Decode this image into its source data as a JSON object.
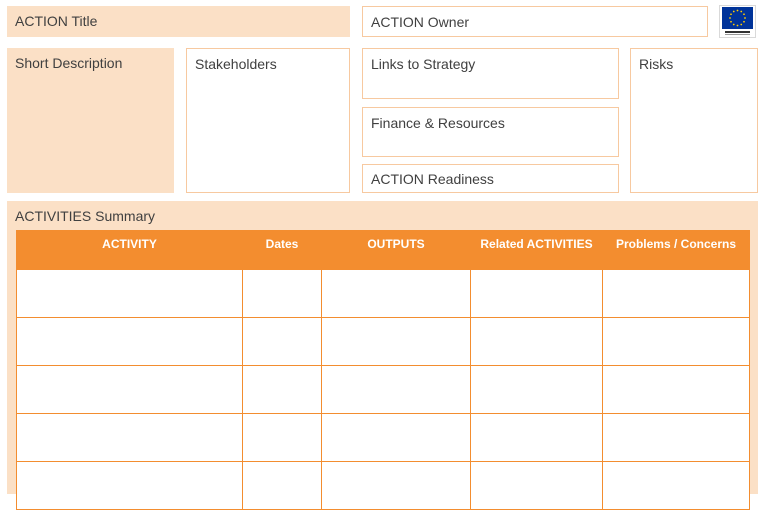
{
  "header": {
    "action_title_label": "ACTION Title",
    "action_owner_label": "ACTION Owner",
    "eu_logo_text": "European Union"
  },
  "panels": {
    "short_description_label": "Short Description",
    "stakeholders_label": "Stakeholders",
    "links_to_strategy_label": "Links to Strategy",
    "finance_resources_label": "Finance & Resources",
    "action_readiness_label": "ACTION Readiness",
    "risks_label": "Risks"
  },
  "activities": {
    "title": "ACTIVITIES Summary",
    "columns": [
      "ACTIVITY",
      "Dates",
      "OUTPUTS",
      "Related ACTIVITIES",
      "Problems / Concerns"
    ],
    "row_count": 5
  },
  "colors": {
    "peach": "#fbe0c6",
    "orange_header": "#f38d2f",
    "outline": "#f7c9a0",
    "eu_blue": "#003399",
    "eu_gold": "#ffcc00"
  }
}
